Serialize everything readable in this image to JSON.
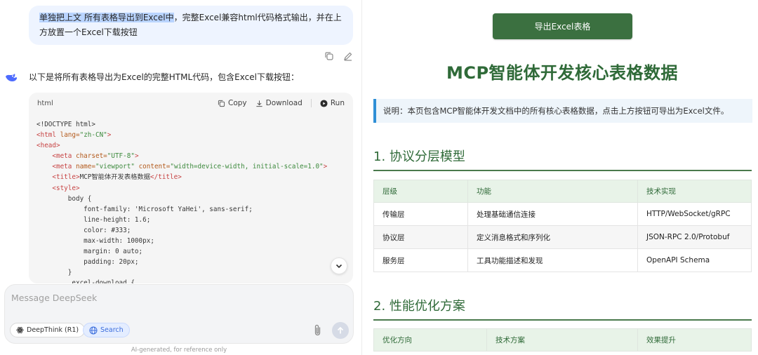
{
  "chat": {
    "user_message_highlight": "单独把上文 所有表格导出到Excel中",
    "user_message_rest": "，完整Excel兼容html代码格式输出，并在上方放置一个Excel下载按钮",
    "assistant_intro": "以下是将所有表格导出为Excel的完整HTML代码，包含Excel下载按钮：",
    "code": {
      "language": "html",
      "copy_label": "Copy",
      "download_label": "Download",
      "run_label": "Run",
      "lines": [
        [
          {
            "t": "<!DOCTYPE html>",
            "c": ""
          }
        ],
        [
          {
            "t": "<html ",
            "c": "tg"
          },
          {
            "t": "lang=",
            "c": "at"
          },
          {
            "t": "\"zh-CN\"",
            "c": "st"
          },
          {
            "t": ">",
            "c": "tg"
          }
        ],
        [
          {
            "t": "<head>",
            "c": "tg"
          }
        ],
        [
          {
            "t": "    <meta ",
            "c": "tg"
          },
          {
            "t": "charset=",
            "c": "at"
          },
          {
            "t": "\"UTF-8\"",
            "c": "st"
          },
          {
            "t": ">",
            "c": "tg"
          }
        ],
        [
          {
            "t": "    <meta ",
            "c": "tg"
          },
          {
            "t": "name=",
            "c": "at"
          },
          {
            "t": "\"viewport\" ",
            "c": "st"
          },
          {
            "t": "content=",
            "c": "at"
          },
          {
            "t": "\"width=device-width, initial-scale=1.0\"",
            "c": "st"
          },
          {
            "t": ">",
            "c": "tg"
          }
        ],
        [
          {
            "t": "    <title>",
            "c": "tg"
          },
          {
            "t": "MCP智能体开发表格数据",
            "c": ""
          },
          {
            "t": "</title>",
            "c": "tg"
          }
        ],
        [
          {
            "t": "    <style>",
            "c": "tg"
          }
        ],
        [
          {
            "t": "        body {",
            "c": ""
          }
        ],
        [
          {
            "t": "            font-family: 'Microsoft YaHei', sans-serif;",
            "c": ""
          }
        ],
        [
          {
            "t": "            line-height: 1.6;",
            "c": ""
          }
        ],
        [
          {
            "t": "            color: #333;",
            "c": ""
          }
        ],
        [
          {
            "t": "            max-width: 1000px;",
            "c": ""
          }
        ],
        [
          {
            "t": "            margin: 0 auto;",
            "c": ""
          }
        ],
        [
          {
            "t": "            padding: 20px;",
            "c": ""
          }
        ],
        [
          {
            "t": "        }",
            "c": ""
          }
        ],
        [
          {
            "t": "        .excel-download {",
            "c": ""
          }
        ]
      ]
    },
    "composer": {
      "placeholder": "Message DeepSeek",
      "deepthink_label": "DeepThink (R1)",
      "search_label": "Search"
    },
    "disclaimer": "AI-generated, for reference only"
  },
  "preview": {
    "export_button": "导出Excel表格",
    "title": "MCP智能体开发核心表格数据",
    "note": "说明：本页包含MCP智能体开发文档中的所有核心表格数据，点击上方按钮可导出为Excel文件。",
    "section1": {
      "title": "1. 协议分层模型",
      "headers": [
        "层级",
        "功能",
        "技术实现"
      ],
      "rows": [
        [
          "传输层",
          "处理基础通信连接",
          "HTTP/WebSocket/gRPC"
        ],
        [
          "协议层",
          "定义消息格式和序列化",
          "JSON-RPC 2.0/Protobuf"
        ],
        [
          "服务层",
          "工具功能描述和发现",
          "OpenAPI Schema"
        ]
      ]
    },
    "section2": {
      "title": "2. 性能优化方案",
      "headers": [
        "优化方向",
        "技术方案",
        "效果提升"
      ]
    }
  }
}
